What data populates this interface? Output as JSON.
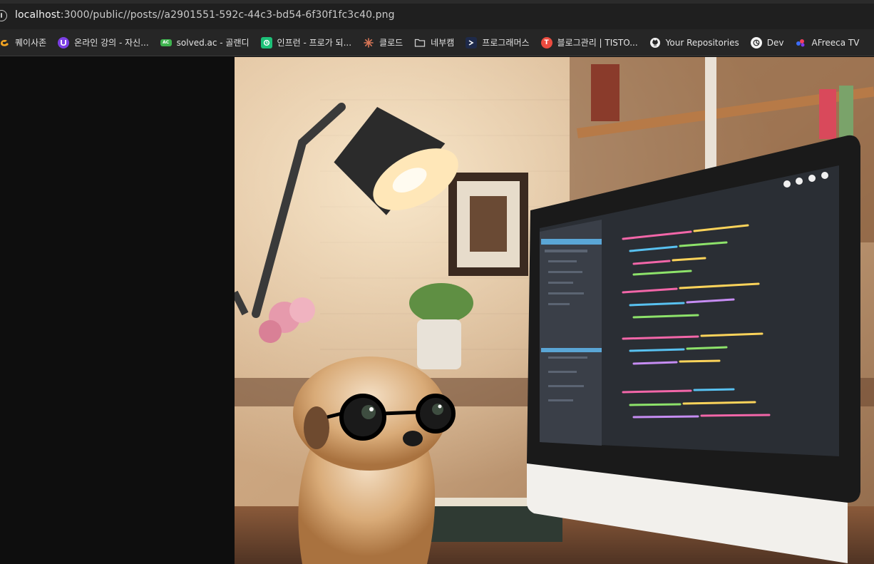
{
  "browser": {
    "url_host": "localhost",
    "url_rest": ":3000/public//posts//a2901551-592c-44c3-bd54-6f30f1fc3c40.png"
  },
  "bookmarks": [
    {
      "label": "퀘이사존",
      "icon": "quasarzone-icon"
    },
    {
      "label": "온라인 강의 - 자신...",
      "icon": "inflearn-u-icon"
    },
    {
      "label": "solved.ac - 골랜디",
      "icon": "solvedac-icon"
    },
    {
      "label": "인프런 - 프로가 되...",
      "icon": "inflearn-icon"
    },
    {
      "label": "클로드",
      "icon": "claude-icon"
    },
    {
      "label": "네부캠",
      "icon": "folder-icon"
    },
    {
      "label": "프로그래머스",
      "icon": "programmers-icon"
    },
    {
      "label": "블로그관리 | TISTO...",
      "icon": "tistory-icon"
    },
    {
      "label": "Your Repositories",
      "icon": "github-icon"
    },
    {
      "label": "Dev",
      "icon": "openai-icon"
    },
    {
      "label": "AFreeca TV",
      "icon": "afreeca-icon"
    }
  ],
  "colors": {
    "tab_bg": "#1f1f1f",
    "bookmarks_bg": "#262626",
    "page_bg": "#0e0e0e"
  },
  "image": {
    "subject": "meerkat with glasses at desk with computer showing code"
  }
}
